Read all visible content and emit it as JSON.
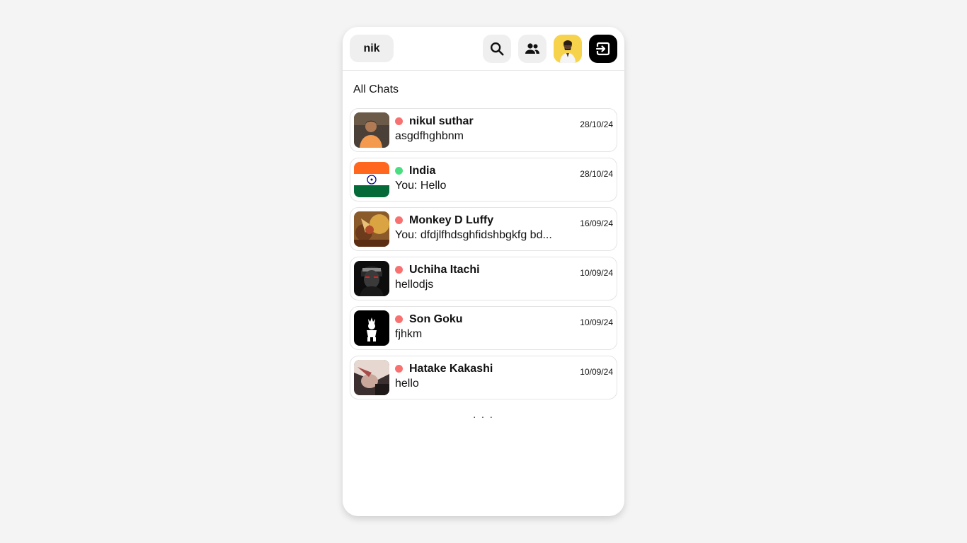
{
  "header": {
    "username": "nik",
    "search_icon": "search-icon",
    "friends_icon": "friends-icon",
    "profile_icon": "profile-avatar",
    "logout_icon": "logout-icon"
  },
  "section_title": "All Chats",
  "colors": {
    "online": "#4ade80",
    "offline": "#f87171",
    "logout_bg": "#000000",
    "profile_bg": "#f7d34b"
  },
  "chats": [
    {
      "name": "nikul suthar",
      "message": "asgdfhghbnm",
      "date": "28/10/24",
      "status": "offline"
    },
    {
      "name": "India",
      "message": "You: Hello",
      "date": "28/10/24",
      "status": "online"
    },
    {
      "name": "Monkey D Luffy",
      "message": "You: dfdjlfhdsghfidshbgkfg bd...",
      "date": "16/09/24",
      "status": "offline"
    },
    {
      "name": "Uchiha Itachi",
      "message": "hellodjs",
      "date": "10/09/24",
      "status": "offline"
    },
    {
      "name": "Son Goku",
      "message": "fjhkm",
      "date": "10/09/24",
      "status": "offline"
    },
    {
      "name": "Hatake Kakashi",
      "message": "hello",
      "date": "10/09/24",
      "status": "offline"
    }
  ],
  "loader_text": ". . ."
}
